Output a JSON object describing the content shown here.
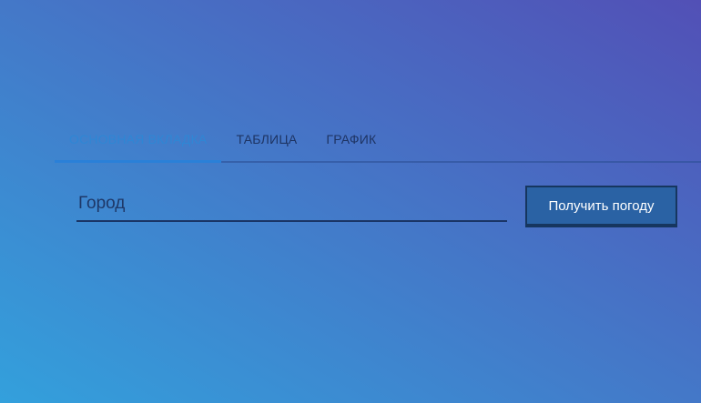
{
  "tabs": [
    {
      "label": "ОСНОВНАЯ ВКЛАДКА",
      "active": true
    },
    {
      "label": "ТАБЛИЦА",
      "active": false
    },
    {
      "label": "ГРАФИК",
      "active": false
    }
  ],
  "form": {
    "city_placeholder": "Город",
    "city_value": "",
    "submit_label": "Получить погоду"
  },
  "colors": {
    "gradient_start": "#33a0dc",
    "gradient_end": "#5250b6",
    "active_tab": "#2f86d4",
    "button_bg": "#2a62a4"
  }
}
